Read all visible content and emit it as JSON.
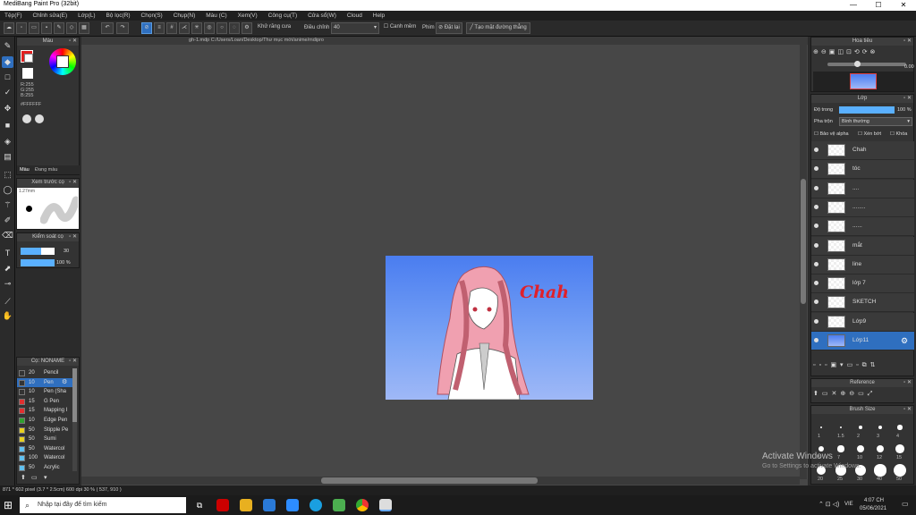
{
  "window": {
    "title": "MediBang Paint Pro (32bit)",
    "minimize": "—",
    "maximize": "☐",
    "close": "✕"
  },
  "menu": [
    "Tệp(F)",
    "Chỉnh sửa(E)",
    "Lớp(L)",
    "Bộ lọc(R)",
    "Chọn(S)",
    "Chụp(N)",
    "Màu (C)",
    "Xem(V)",
    "Công cụ(T)",
    "Cửa sổ(W)",
    "Cloud",
    "Help"
  ],
  "toolbar": {
    "antialias": "Khử răng cưa",
    "adjust_label": "Điều chỉnh",
    "adjust_value": "40",
    "edge": "Canh mềm",
    "pen_label": "Phim",
    "tilt": "Đặt lại",
    "straight": "Tạo mặt đường thẳng"
  },
  "color_panel": {
    "title": "Màu",
    "r": "R:255",
    "g": "G:255",
    "b": "B:255",
    "hex": "#FFFFFF",
    "tab_color": "Màu",
    "tab_palette": "Đang màu"
  },
  "brush_preview": {
    "title": "Xem trước cọ",
    "size": "1.27mm"
  },
  "brush_control": {
    "title": "Kiểm soát cọ",
    "size": "30",
    "opacity": "100 %"
  },
  "brush_list": {
    "title": "Cọ: NONAME",
    "items": [
      {
        "size": "20",
        "name": "Pencil",
        "color": "#333333",
        "selected": false
      },
      {
        "size": "10",
        "name": "Pen",
        "color": "#333333",
        "selected": true
      },
      {
        "size": "10",
        "name": "Pen (Sha",
        "color": "#333333",
        "selected": false
      },
      {
        "size": "15",
        "name": "G Pen",
        "color": "#e03030",
        "selected": false
      },
      {
        "size": "15",
        "name": "Mapping I",
        "color": "#e03030",
        "selected": false
      },
      {
        "size": "10",
        "name": "Edge Pen",
        "color": "#30a030",
        "selected": false
      },
      {
        "size": "50",
        "name": "Stipple Pe",
        "color": "#e8d020",
        "selected": false
      },
      {
        "size": "50",
        "name": "Sumi",
        "color": "#e8d020",
        "selected": false
      },
      {
        "size": "50",
        "name": "Watercol",
        "color": "#60c0f0",
        "selected": false
      },
      {
        "size": "100",
        "name": "Watercol",
        "color": "#60c0f0",
        "selected": false
      },
      {
        "size": "50",
        "name": "Acrylic",
        "color": "#60c0f0",
        "selected": false
      }
    ]
  },
  "file_path": "gh-1.mdp    C:/Users/Loan/Desktop/Thư mục mới/anime/mdipro",
  "artwork": {
    "text": "Chah"
  },
  "navigator": {
    "title": "Hoa tiêu",
    "zoom": "0.00"
  },
  "layer_panel": {
    "title": "Lớp",
    "opacity_label": "Độ trong",
    "opacity_value": "100 %",
    "blend_label": "Pha trộn",
    "blend_value": "Bình thường",
    "protect_alpha": "Bảo vệ alpha",
    "clipping": "Xén bớt",
    "lock": "Khóa",
    "layers": [
      {
        "name": "Chah",
        "selected": false
      },
      {
        "name": "tóc",
        "selected": false
      },
      {
        "name": "....",
        "selected": false
      },
      {
        "name": "........",
        "selected": false
      },
      {
        "name": "......",
        "selected": false
      },
      {
        "name": "mắt",
        "selected": false
      },
      {
        "name": "line",
        "selected": false
      },
      {
        "name": "lớp 7",
        "selected": false
      },
      {
        "name": "SKETCH",
        "selected": false
      },
      {
        "name": "Lớp9",
        "selected": false
      },
      {
        "name": "Lớp11",
        "selected": true
      }
    ]
  },
  "reference": {
    "title": "Reference"
  },
  "brush_size": {
    "title": "Brush Size",
    "labels": [
      "1",
      "1.5",
      "2",
      "3",
      "4",
      "5",
      "7",
      "10",
      "12",
      "15",
      "20",
      "25",
      "30",
      "40",
      "50"
    ]
  },
  "status": "871 * 602 pixel   (3.7 * 2.5cm)   600 dpi   30 %   ( 537, 910 )",
  "watermark": {
    "line1": "Activate Windows",
    "line2": "Go to Settings to activate Windows."
  },
  "taskbar": {
    "search": "Nhập tại đây để tìm kiếm",
    "time": "4:07 CH",
    "date": "05/06/2021",
    "lang": "VIE"
  },
  "colors": {
    "accent": "#2f6fbf",
    "canvas_bg": "#474747"
  }
}
